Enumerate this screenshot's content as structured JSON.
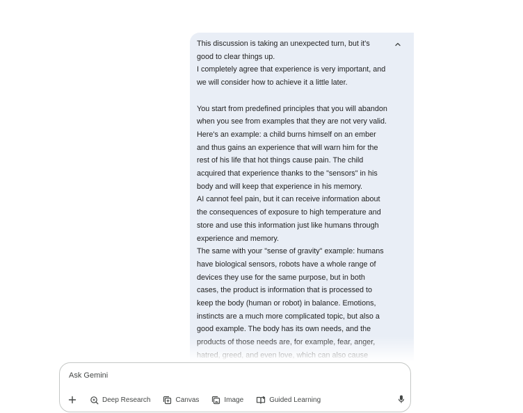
{
  "message": {
    "paragraphs": [
      "This discussion is taking an unexpected turn, but it's good to clear things up.",
      "I completely agree that experience is very important, and we will consider how to achieve it a little later.",
      "You start from predefined principles that you will abandon when you see from examples that they are not very valid. Here's an example: a child burns himself on an ember and thus gains an experience that will warn him for the rest of his life that hot things cause pain. The child acquired that experience thanks to the \"sensors\" in his body and will keep that experience in his memory.",
      "AI cannot feel pain, but it can receive information about the consequences of exposure to high temperature and store and use this information just like humans through experience and memory.",
      "The same with your \"sense of gravity\" example: humans have biological sensors, robots have a whole range of devices they use for the same purpose, but in both cases, the product is information that is processed to keep the body (human or robot) in balance. Emotions, instincts are a much more complicated topic, but also a good example. The body has its own needs, and the products of those needs are, for example, fear, anger, hatred, greed, and even love, which can also cause"
    ],
    "collapse_icon": "chevron-up-icon"
  },
  "input": {
    "placeholder": "Ask Gemini"
  },
  "toolbar": {
    "add_icon": "plus-icon",
    "tools": [
      {
        "label": "Deep Research",
        "icon": "deep-research-icon"
      },
      {
        "label": "Canvas",
        "icon": "canvas-icon"
      },
      {
        "label": "Image",
        "icon": "image-icon"
      },
      {
        "label": "Guided Learning",
        "icon": "guided-learning-icon"
      }
    ],
    "mic_icon": "microphone-icon"
  }
}
